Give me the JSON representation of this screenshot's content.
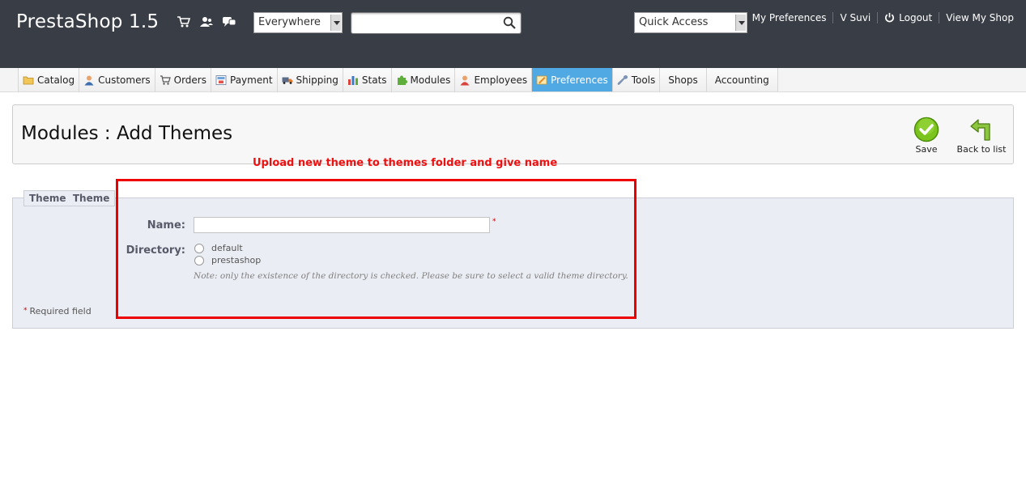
{
  "header": {
    "logo": "PrestaShop 1.5",
    "search_scope": "Everywhere",
    "search_placeholder": "",
    "quick_access": "Quick Access",
    "links": {
      "preferences": "My Preferences",
      "user": "V Suvi",
      "logout": "Logout",
      "view_shop": "View My Shop"
    },
    "icons": [
      "cart-icon",
      "customers-icon",
      "messages-icon"
    ]
  },
  "nav": {
    "tabs": [
      {
        "label": "Catalog",
        "icon": "folder-icon"
      },
      {
        "label": "Customers",
        "icon": "customer-icon"
      },
      {
        "label": "Orders",
        "icon": "cart-icon"
      },
      {
        "label": "Payment",
        "icon": "payment-icon"
      },
      {
        "label": "Shipping",
        "icon": "truck-icon"
      },
      {
        "label": "Stats",
        "icon": "stats-icon"
      },
      {
        "label": "Modules",
        "icon": "puzzle-icon"
      },
      {
        "label": "Employees",
        "icon": "employee-icon"
      },
      {
        "label": "Preferences",
        "icon": "preferences-icon",
        "active": true
      },
      {
        "label": "Tools",
        "icon": "wrench-icon"
      },
      {
        "label": "Shops",
        "icon": ""
      },
      {
        "label": "Accounting",
        "icon": ""
      }
    ],
    "active_color": "#50a9e3"
  },
  "toolbar": {
    "title": "Modules : Add Themes",
    "save_label": "Save",
    "back_label": "Back to list"
  },
  "annotation": "Upload new theme to themes folder and give name",
  "form": {
    "legend": "Theme  Theme",
    "name_label": "Name:",
    "name_value": "",
    "required_marker": "*",
    "directory_label": "Directory:",
    "directories": [
      "default",
      "prestashop"
    ],
    "note": "Note: only the existence of the directory is checked. Please be sure to select a valid theme directory.",
    "required_field_text": "Required field"
  },
  "colors": {
    "header_bg": "#393d46",
    "annotation_red": "#ee1111",
    "fieldset_bg": "#ebedf4"
  }
}
